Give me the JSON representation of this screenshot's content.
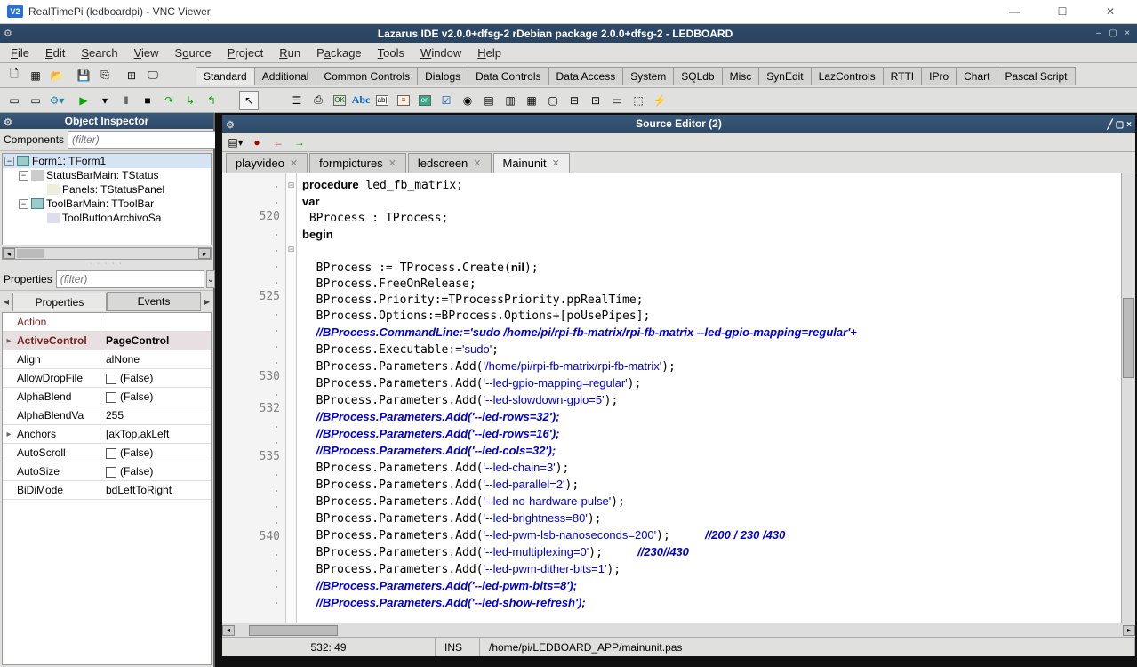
{
  "vnc": {
    "title": "RealTimePi (ledboardpi) - VNC Viewer",
    "logo": "V2"
  },
  "ide": {
    "title": "Lazarus IDE v2.0.0+dfsg-2 rDebian package 2.0.0+dfsg-2 - LEDBOARD"
  },
  "menu": [
    "File",
    "Edit",
    "Search",
    "View",
    "Source",
    "Project",
    "Run",
    "Package",
    "Tools",
    "Window",
    "Help"
  ],
  "component_tabs": [
    "Standard",
    "Additional",
    "Common Controls",
    "Dialogs",
    "Data Controls",
    "Data Access",
    "System",
    "SQLdb",
    "Misc",
    "SynEdit",
    "LazControls",
    "RTTI",
    "IPro",
    "Chart",
    "Pascal Script"
  ],
  "inspector": {
    "title": "Object Inspector",
    "comp_label": "Components",
    "filter_ph": "(filter)",
    "tree": [
      "Form1: TForm1",
      "StatusBarMain: TStatus",
      "Panels: TStatusPanel",
      "ToolBarMain: TToolBar",
      "ToolButtonArchivoSa"
    ],
    "prop_label": "Properties",
    "tabs": [
      "Properties",
      "Events"
    ],
    "rows": [
      {
        "name": "Action",
        "val": ""
      },
      {
        "name": "ActiveControl",
        "val": "PageControl",
        "sel": true
      },
      {
        "name": "Align",
        "val": "alNone"
      },
      {
        "name": "AllowDropFile",
        "val": "(False)",
        "cb": true
      },
      {
        "name": "AlphaBlend",
        "val": "(False)",
        "cb": true
      },
      {
        "name": "AlphaBlendVa",
        "val": "255"
      },
      {
        "name": "Anchors",
        "val": "[akTop,akLeft",
        "exp": true
      },
      {
        "name": "AutoScroll",
        "val": "(False)",
        "cb": true
      },
      {
        "name": "AutoSize",
        "val": "(False)",
        "cb": true
      },
      {
        "name": "BiDiMode",
        "val": "bdLeftToRight"
      }
    ]
  },
  "source": {
    "title": "Source Editor (2)",
    "tabs": [
      "playvideo",
      "formpictures",
      "ledscreen",
      "Mainunit"
    ],
    "active_tab": 3,
    "gutter": [
      ".",
      ".",
      "520",
      ".",
      ".",
      ".",
      ".",
      "525",
      ".",
      ".",
      ".",
      ".",
      "530",
      ".",
      "532",
      ".",
      ".",
      "535",
      ".",
      ".",
      ".",
      ".",
      "540",
      ".",
      ".",
      ".",
      "."
    ],
    "status": {
      "pos": "532: 49",
      "mode": "INS",
      "path": "/home/pi/LEDBOARD_APP/mainunit.pas"
    }
  }
}
